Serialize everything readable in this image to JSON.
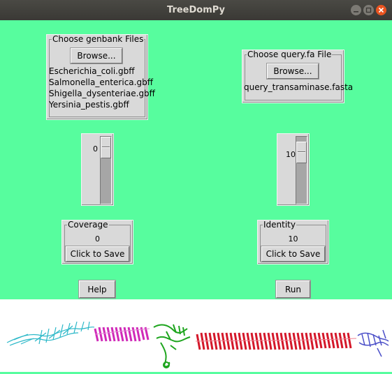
{
  "window": {
    "title": "TreeDomPy",
    "controls": [
      "minimize-icon",
      "maximize-icon",
      "close-icon"
    ],
    "background_color": "#57fd9e"
  },
  "genbank": {
    "legend": "Choose genbank  Files",
    "browse_label": "Browse...",
    "files": [
      "Escherichia_coli.gbff",
      "Salmonella_enterica.gbff",
      "Shigella_dysenteriae.gbff",
      "Yersinia_pestis.gbff"
    ]
  },
  "query": {
    "legend": "Choose query.fa File",
    "browse_label": "Browse...",
    "file": "query_transaminase.fasta"
  },
  "coverage_scale": {
    "value_label": "0",
    "level_fraction": 0.0
  },
  "identity_scale": {
    "value_label": "10",
    "level_fraction": 0.1
  },
  "coverage": {
    "legend": "Coverage",
    "value": "0",
    "save_label": "Click to Save"
  },
  "identity": {
    "legend": "Identity",
    "value": "10",
    "save_label": "Click to Save"
  },
  "help_label": "Help",
  "run_label": "Run",
  "image": {
    "subject": "protein-structure-ribbon"
  }
}
